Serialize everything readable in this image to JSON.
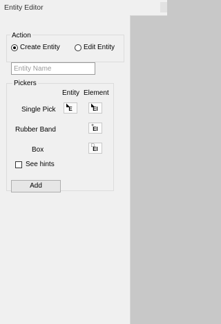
{
  "window": {
    "title": "Entity Editor"
  },
  "action": {
    "label": "Action",
    "options": [
      {
        "label": "Create Entity",
        "selected": true
      },
      {
        "label": "Edit Entity",
        "selected": false
      }
    ]
  },
  "entity_name": {
    "placeholder": "Entity Name",
    "value": ""
  },
  "pickers": {
    "label": "Pickers",
    "columns": [
      "Entity",
      "Element"
    ],
    "rows": [
      {
        "label": "Single Pick",
        "entity_glyph": "E",
        "element_glyph": "El"
      },
      {
        "label": "Rubber Band",
        "element_glyph": "El"
      },
      {
        "label": "Box",
        "element_glyph": "El"
      }
    ],
    "see_hints": {
      "label": "See hints",
      "checked": false
    }
  },
  "add_button": {
    "label": "Add"
  }
}
